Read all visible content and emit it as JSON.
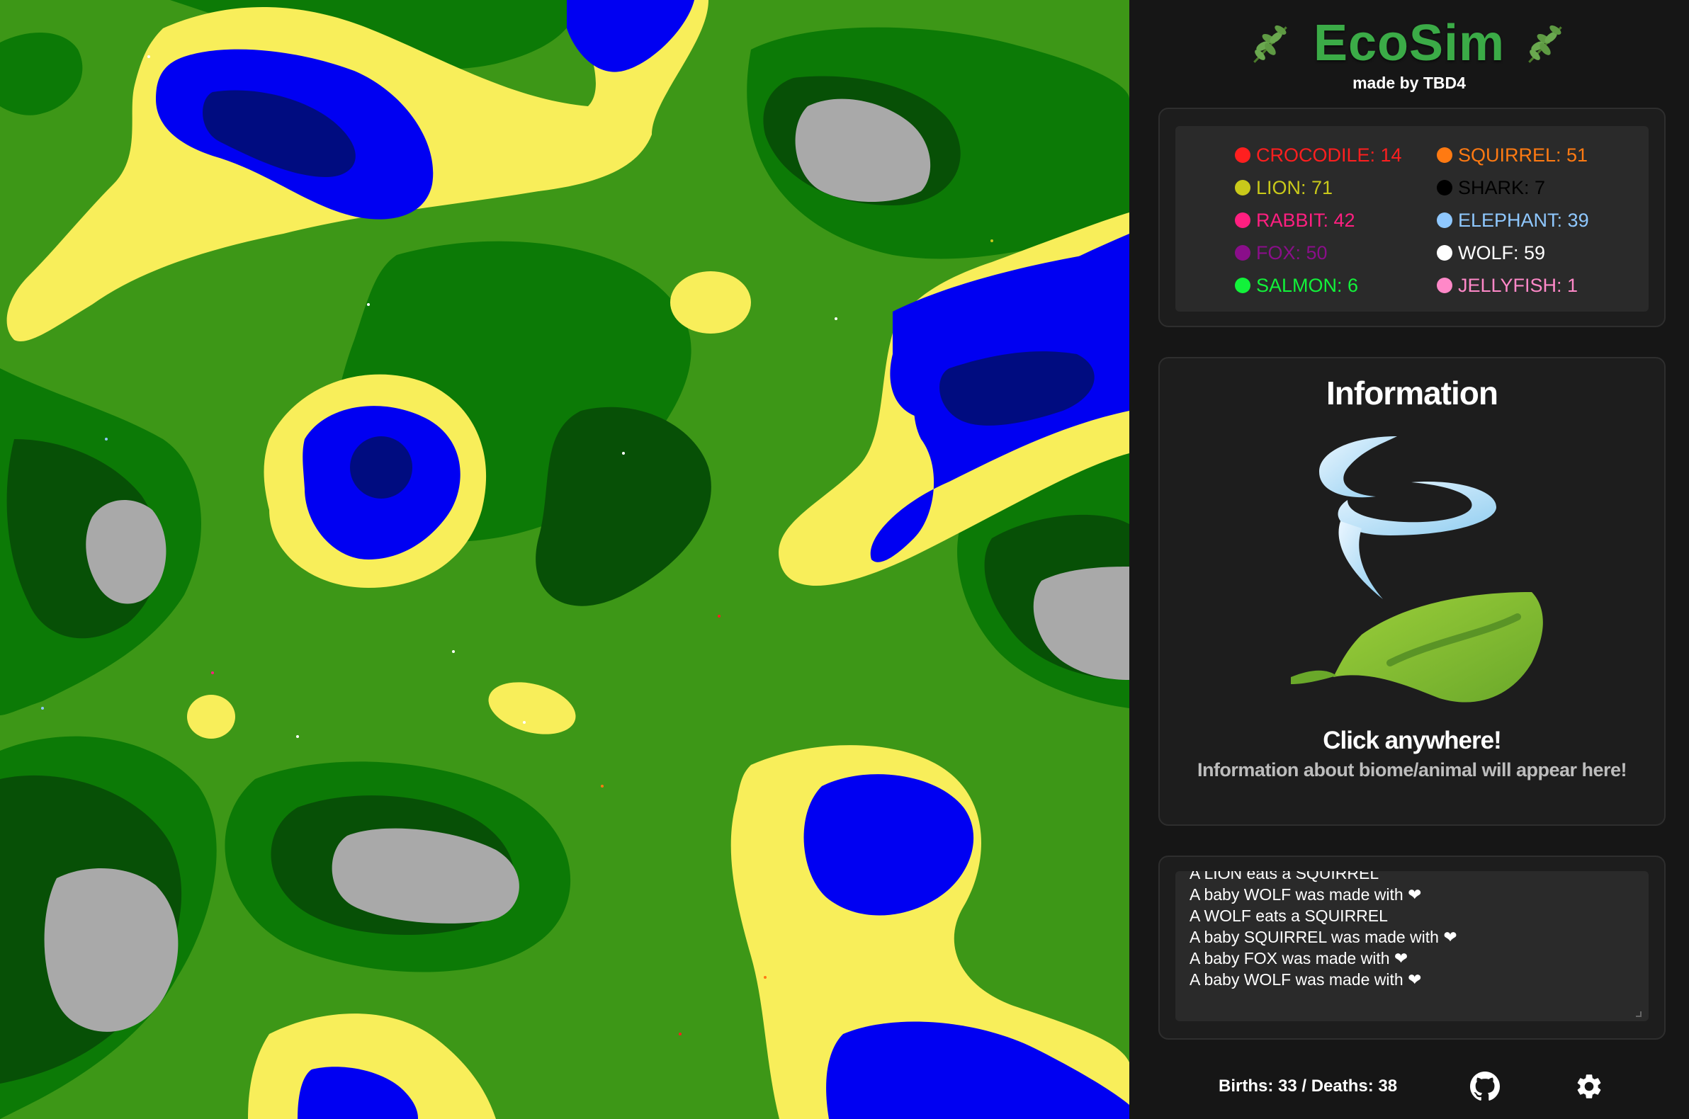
{
  "app": {
    "title": "EcoSim",
    "subtitle": "made by TBD4",
    "left_emoji_icon": "herb-icon",
    "right_emoji_icon": "herb-icon"
  },
  "population": [
    {
      "label": "CROCODILE: 14",
      "color": "#ff1f1f"
    },
    {
      "label": "SQUIRREL: 51",
      "color": "#ff7a12"
    },
    {
      "label": "LION: 71",
      "color": "#c9c91a"
    },
    {
      "label": "SHARK: 7",
      "color": "#000000"
    },
    {
      "label": "RABBIT: 42",
      "color": "#ff1f80"
    },
    {
      "label": "ELEPHANT: 39",
      "color": "#8fc8ff"
    },
    {
      "label": "FOX: 50",
      "color": "#8a0e8a"
    },
    {
      "label": "WOLF: 59",
      "color": "#ffffff"
    },
    {
      "label": "SALMON: 6",
      "color": "#12f23a"
    },
    {
      "label": "JELLYFISH: 1",
      "color": "#ff88c8"
    }
  ],
  "info": {
    "heading": "Information",
    "icon": "leaf-fluttering-in-wind-icon",
    "prompt": "Click anywhere!",
    "hint": "Information about biome/animal will appear here!"
  },
  "log": [
    "A LION eats a SQUIRREL",
    "A baby WOLF was made with ❤",
    "A WOLF eats a SQUIRREL",
    "A baby SQUIRREL was made with ❤",
    "A baby FOX was made with ❤",
    "A baby WOLF was made with ❤"
  ],
  "footer": {
    "stats": "Births: 33 / Deaths: 38",
    "github_icon": "github-icon",
    "settings_icon": "gear-icon"
  },
  "biome_colors": {
    "deep_water": "#000c80",
    "water": "#0000f2",
    "sand": "#f8ee5a",
    "grass": "#3d9717",
    "forest": "#0c7a06",
    "dense_forest": "#075006",
    "dark_forest": "#053d04",
    "mountain": "#a9a9a9"
  }
}
